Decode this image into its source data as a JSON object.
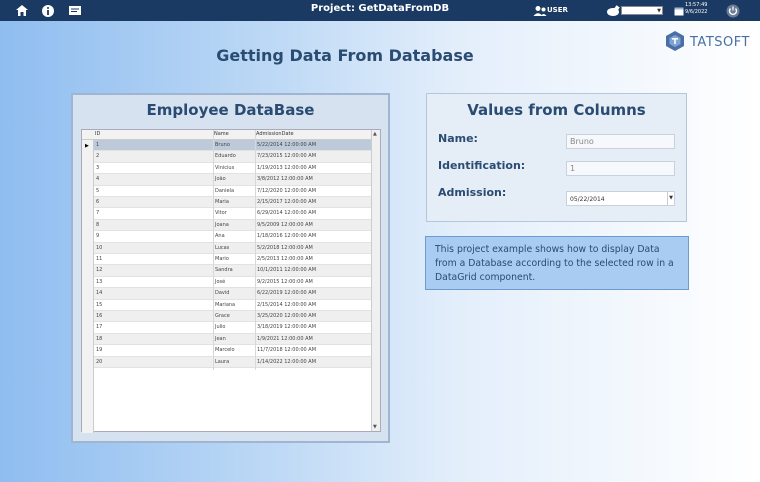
{
  "topbar": {
    "project_title": "Project: GetDataFromDB",
    "user_label": "USER",
    "time": "13:57:49",
    "date": "9/6/2022",
    "icons": [
      "home-icon",
      "info-icon",
      "message-icon",
      "user-icon",
      "pencil-icon",
      "calendar-icon",
      "power-icon"
    ]
  },
  "page": {
    "heading": "Getting Data From Database",
    "logo_text": "TATSOFT"
  },
  "employee_panel": {
    "title": "Employee DataBase",
    "columns": [
      "ID",
      "Name",
      "AdmissionDate"
    ],
    "rows": [
      [
        "1",
        "Bruno",
        "5/22/2014 12:00:00 AM"
      ],
      [
        "2",
        "Eduardo",
        "7/23/2015 12:00:00 AM"
      ],
      [
        "3",
        "Vinicius",
        "1/19/2013 12:00:00 AM"
      ],
      [
        "4",
        "João",
        "3/8/2012 12:00:00 AM"
      ],
      [
        "5",
        "Daniela",
        "7/12/2020 12:00:00 AM"
      ],
      [
        "6",
        "Maria",
        "2/15/2017 12:00:00 AM"
      ],
      [
        "7",
        "Vitor",
        "6/29/2014 12:00:00 AM"
      ],
      [
        "8",
        "Joana",
        "9/5/2009 12:00:00 AM"
      ],
      [
        "9",
        "Ana",
        "1/18/2016 12:00:00 AM"
      ],
      [
        "10",
        "Lucas",
        "5/2/2018 12:00:00 AM"
      ],
      [
        "11",
        "Mario",
        "2/5/2013 12:00:00 AM"
      ],
      [
        "12",
        "Sandra",
        "10/1/2011 12:00:00 AM"
      ],
      [
        "13",
        "José",
        "9/2/2015 12:00:00 AM"
      ],
      [
        "14",
        "David",
        "6/22/2019 12:00:00 AM"
      ],
      [
        "15",
        "Mariana",
        "2/15/2014 12:00:00 AM"
      ],
      [
        "16",
        "Grace",
        "3/25/2020 12:00:00 AM"
      ],
      [
        "17",
        "Julio",
        "3/18/2019 12:00:00 AM"
      ],
      [
        "18",
        "Jean",
        "1/9/2021 12:00:00 AM"
      ],
      [
        "19",
        "Marcelo",
        "11/7/2018 12:00:00 AM"
      ],
      [
        "20",
        "Laura",
        "1/14/2022 12:00:00 AM"
      ]
    ],
    "selected_row": 0
  },
  "values_panel": {
    "title": "Values from Columns",
    "name_label": "Name:",
    "name_value": "Bruno",
    "identification_label": "Identification:",
    "identification_value": "1",
    "admission_label": "Admission:",
    "admission_value": "05/22/2014"
  },
  "note": {
    "text": "This project example shows how to display Data from a Database according to the selected row in a DataGrid component."
  },
  "colors": {
    "topbar": "#1b3a63",
    "heading": "#2a4b72",
    "selected_row": "#bccada",
    "note_background": "#a9cdf2"
  }
}
